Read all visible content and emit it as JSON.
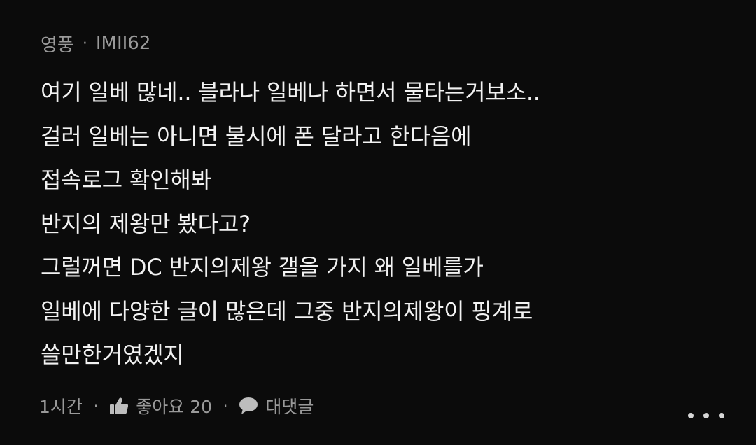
{
  "comment": {
    "author": "영풍",
    "separator": "·",
    "user_id": "IMII62",
    "lines": [
      "여기 일베 많네.. 블라나 일베나 하면서 물타는거보소..",
      "걸러 일베는 아니면 불시에 폰 달라고 한다음에",
      "접속로그 확인해봐",
      "반지의 제왕만 봤다고?",
      "그럴꺼면 DC 반지의제왕 갤을 가지 왜 일베를가",
      "일베에 다양한 글이 많은데 그중 반지의제왕이 핑계로",
      "쓸만한거였겠지"
    ],
    "time": "1시간",
    "like_label": "좋아요 20",
    "reply_label": "대댓글",
    "icons": {
      "like": "thumbs-up-icon",
      "reply": "speech-bubble-icon",
      "more": "more-dots-icon"
    },
    "colors": {
      "background": "#0b0b0b",
      "text": "#f2f2f2",
      "meta": "#9a9a9a"
    }
  }
}
